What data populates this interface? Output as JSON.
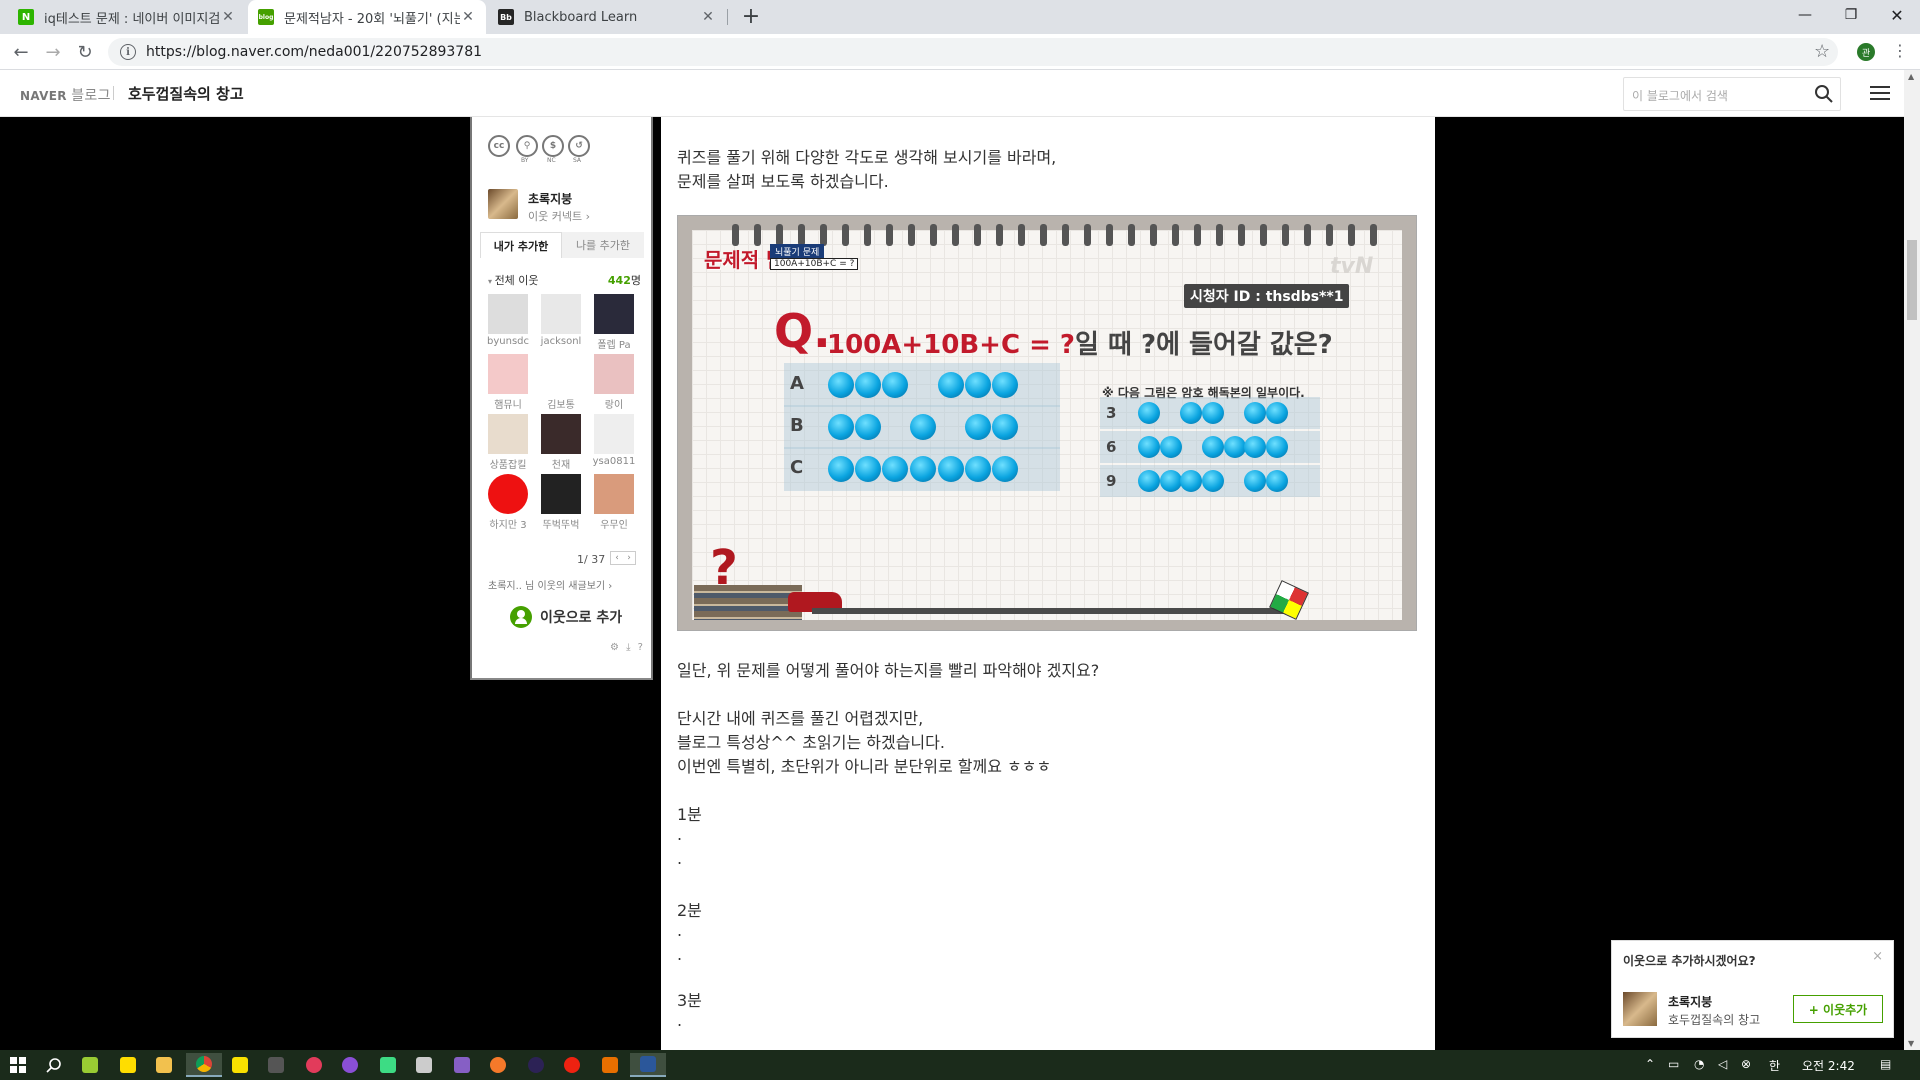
{
  "browser": {
    "tabs": [
      {
        "title": "iq테스트 문제 : 네이버 이미지검",
        "favicon": "N",
        "favicon_color": "#2db400",
        "active": false
      },
      {
        "title": "문제적남자 - 20회 '뇌풀기' (지는",
        "favicon": "blog",
        "favicon_color": "#45a000",
        "active": true
      },
      {
        "title": "Blackboard Learn",
        "favicon": "Bb",
        "favicon_color": "#262626",
        "active": false
      }
    ],
    "new_tab": "+",
    "url": "https://blog.naver.com/neda001/220752893781",
    "profile_initial": "관"
  },
  "blog_header": {
    "naver": "NAVER",
    "blog": "블로그",
    "blog_name": "호두껍질속의 창고",
    "search_placeholder": "이 블로그에서 검색"
  },
  "widget": {
    "cc_icons": [
      "cc",
      "by",
      "nc",
      "sa"
    ],
    "cc_labels": [
      "BY",
      "NC",
      "SA"
    ],
    "profile_name": "초록지붕",
    "profile_sub": "이웃 커넥트 ›",
    "tab_mine": "내가 추가한",
    "tab_others": "나를 추가한",
    "all_neighbors": "전체 이웃",
    "count": "442",
    "count_unit": "명",
    "neighbors": [
      "byunsdc",
      "jacksonl",
      "폴렙 Pa",
      "햄뮤니",
      "김보통",
      "랑이",
      "상품잡킬",
      "천재",
      "ysa0811",
      "하지만 3",
      "뚜벅뚜벅",
      "우무인"
    ],
    "page": "1/ 37",
    "pager_prev": "‹",
    "pager_next": "›",
    "news": "초록지.. 님 이웃의 새글보기 ›",
    "add_button": "이웃으로 추가",
    "tools": "⚙ ⤓ ?"
  },
  "post": {
    "line1": "퀴즈를 풀기 위해 다양한 각도로 생각해 보시기를 바라며,",
    "line2": "문제를 살펴 보도록 하겠습니다.",
    "quiz_image": {
      "show_title": "문제적 남자",
      "tag": "뇌풀기 문제",
      "tag2": "100A+10B+C = ?",
      "viewer": "시청자 ID : thsdbs**1",
      "logo": "tvN",
      "q": "Q.",
      "question_red": "100A+10B+C = ?",
      "question_mid": "일 때 ",
      "question_mark": "?",
      "question_end": "에 들어갈 값은?",
      "hint": "※ 다음 그림은 암호 해독본의 일부이다.",
      "rows_left": [
        "A",
        "B",
        "C"
      ],
      "rows_right": [
        "3",
        "6",
        "9"
      ],
      "question_mark_big": "?"
    },
    "line3": "일단, 위 문제를 어떻게 풀어야 하는지를 빨리 파악해야 겠지요?",
    "line4": "단시간 내에 퀴즈를 풀긴 어렵겠지만,",
    "line5": "블로그 특성상^^ 초읽기는 하겠습니다.",
    "line6": "이번엔 특별히, 초단위가 아니라 분단위로 할께요 ㅎㅎㅎ",
    "m1": "1분",
    "m2": "2분",
    "m3": "3분",
    "dot": "."
  },
  "popup": {
    "question": "이웃으로 추가하시겠어요?",
    "close": "×",
    "name": "초록지붕",
    "blog": "호두껍질속의 창고",
    "button": "+ 이웃추가"
  },
  "taskbar": {
    "time_ampm": "오전 2:42",
    "ime": "한"
  }
}
